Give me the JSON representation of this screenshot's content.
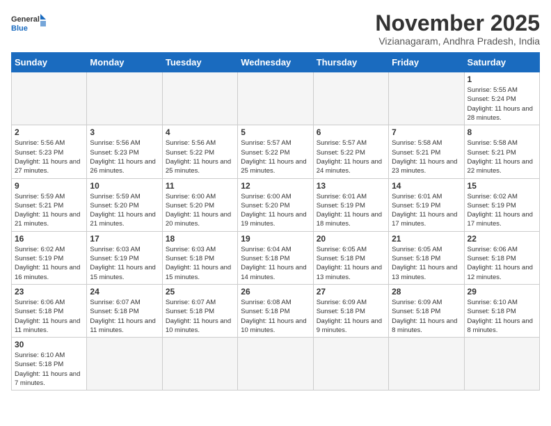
{
  "logo": {
    "text_general": "General",
    "text_blue": "Blue"
  },
  "title": {
    "month": "November 2025",
    "location": "Vizianagaram, Andhra Pradesh, India"
  },
  "headers": [
    "Sunday",
    "Monday",
    "Tuesday",
    "Wednesday",
    "Thursday",
    "Friday",
    "Saturday"
  ],
  "days": [
    {
      "num": "",
      "empty": true
    },
    {
      "num": "",
      "empty": true
    },
    {
      "num": "",
      "empty": true
    },
    {
      "num": "",
      "empty": true
    },
    {
      "num": "",
      "empty": true
    },
    {
      "num": "",
      "empty": true
    },
    {
      "num": "1",
      "sunrise": "5:55 AM",
      "sunset": "5:24 PM",
      "daylight": "11 hours and 28 minutes."
    },
    {
      "num": "2",
      "sunrise": "5:56 AM",
      "sunset": "5:23 PM",
      "daylight": "11 hours and 27 minutes."
    },
    {
      "num": "3",
      "sunrise": "5:56 AM",
      "sunset": "5:23 PM",
      "daylight": "11 hours and 26 minutes."
    },
    {
      "num": "4",
      "sunrise": "5:56 AM",
      "sunset": "5:22 PM",
      "daylight": "11 hours and 25 minutes."
    },
    {
      "num": "5",
      "sunrise": "5:57 AM",
      "sunset": "5:22 PM",
      "daylight": "11 hours and 25 minutes."
    },
    {
      "num": "6",
      "sunrise": "5:57 AM",
      "sunset": "5:22 PM",
      "daylight": "11 hours and 24 minutes."
    },
    {
      "num": "7",
      "sunrise": "5:58 AM",
      "sunset": "5:21 PM",
      "daylight": "11 hours and 23 minutes."
    },
    {
      "num": "8",
      "sunrise": "5:58 AM",
      "sunset": "5:21 PM",
      "daylight": "11 hours and 22 minutes."
    },
    {
      "num": "9",
      "sunrise": "5:59 AM",
      "sunset": "5:21 PM",
      "daylight": "11 hours and 21 minutes."
    },
    {
      "num": "10",
      "sunrise": "5:59 AM",
      "sunset": "5:20 PM",
      "daylight": "11 hours and 21 minutes."
    },
    {
      "num": "11",
      "sunrise": "6:00 AM",
      "sunset": "5:20 PM",
      "daylight": "11 hours and 20 minutes."
    },
    {
      "num": "12",
      "sunrise": "6:00 AM",
      "sunset": "5:20 PM",
      "daylight": "11 hours and 19 minutes."
    },
    {
      "num": "13",
      "sunrise": "6:01 AM",
      "sunset": "5:19 PM",
      "daylight": "11 hours and 18 minutes."
    },
    {
      "num": "14",
      "sunrise": "6:01 AM",
      "sunset": "5:19 PM",
      "daylight": "11 hours and 17 minutes."
    },
    {
      "num": "15",
      "sunrise": "6:02 AM",
      "sunset": "5:19 PM",
      "daylight": "11 hours and 17 minutes."
    },
    {
      "num": "16",
      "sunrise": "6:02 AM",
      "sunset": "5:19 PM",
      "daylight": "11 hours and 16 minutes."
    },
    {
      "num": "17",
      "sunrise": "6:03 AM",
      "sunset": "5:19 PM",
      "daylight": "11 hours and 15 minutes."
    },
    {
      "num": "18",
      "sunrise": "6:03 AM",
      "sunset": "5:18 PM",
      "daylight": "11 hours and 15 minutes."
    },
    {
      "num": "19",
      "sunrise": "6:04 AM",
      "sunset": "5:18 PM",
      "daylight": "11 hours and 14 minutes."
    },
    {
      "num": "20",
      "sunrise": "6:05 AM",
      "sunset": "5:18 PM",
      "daylight": "11 hours and 13 minutes."
    },
    {
      "num": "21",
      "sunrise": "6:05 AM",
      "sunset": "5:18 PM",
      "daylight": "11 hours and 13 minutes."
    },
    {
      "num": "22",
      "sunrise": "6:06 AM",
      "sunset": "5:18 PM",
      "daylight": "11 hours and 12 minutes."
    },
    {
      "num": "23",
      "sunrise": "6:06 AM",
      "sunset": "5:18 PM",
      "daylight": "11 hours and 11 minutes."
    },
    {
      "num": "24",
      "sunrise": "6:07 AM",
      "sunset": "5:18 PM",
      "daylight": "11 hours and 11 minutes."
    },
    {
      "num": "25",
      "sunrise": "6:07 AM",
      "sunset": "5:18 PM",
      "daylight": "11 hours and 10 minutes."
    },
    {
      "num": "26",
      "sunrise": "6:08 AM",
      "sunset": "5:18 PM",
      "daylight": "11 hours and 10 minutes."
    },
    {
      "num": "27",
      "sunrise": "6:09 AM",
      "sunset": "5:18 PM",
      "daylight": "11 hours and 9 minutes."
    },
    {
      "num": "28",
      "sunrise": "6:09 AM",
      "sunset": "5:18 PM",
      "daylight": "11 hours and 8 minutes."
    },
    {
      "num": "29",
      "sunrise": "6:10 AM",
      "sunset": "5:18 PM",
      "daylight": "11 hours and 8 minutes."
    },
    {
      "num": "30",
      "sunrise": "6:10 AM",
      "sunset": "5:18 PM",
      "daylight": "11 hours and 7 minutes."
    },
    {
      "num": "",
      "empty": true
    },
    {
      "num": "",
      "empty": true
    },
    {
      "num": "",
      "empty": true
    },
    {
      "num": "",
      "empty": true
    },
    {
      "num": "",
      "empty": true
    },
    {
      "num": "",
      "empty": true
    }
  ],
  "labels": {
    "sunrise": "Sunrise:",
    "sunset": "Sunset:",
    "daylight": "Daylight:"
  }
}
